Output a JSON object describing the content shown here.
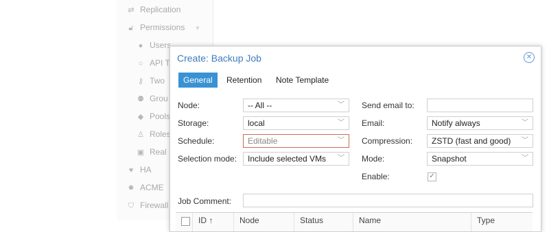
{
  "sidebar": {
    "items": [
      {
        "label": "Replication",
        "icon": "replication-icon"
      },
      {
        "label": "Permissions",
        "icon": "unlock-icon"
      },
      {
        "label": "Users",
        "icon": "user-icon"
      },
      {
        "label": "API T",
        "icon": "person-outline-icon"
      },
      {
        "label": "Two",
        "icon": "key-icon"
      },
      {
        "label": "Grou",
        "icon": "group-icon"
      },
      {
        "label": "Pools",
        "icon": "tags-icon"
      },
      {
        "label": "Roles",
        "icon": "male-icon"
      },
      {
        "label": "Real",
        "icon": "address-book-icon"
      },
      {
        "label": "HA",
        "icon": "heartbeat-icon"
      },
      {
        "label": "ACME",
        "icon": "certificate-icon"
      },
      {
        "label": "Firewall",
        "icon": "shield-icon"
      }
    ]
  },
  "dialog": {
    "title": "Create: Backup Job",
    "tabs": [
      "General",
      "Retention",
      "Note Template"
    ],
    "active_tab": "General",
    "fields": {
      "node": {
        "label": "Node:",
        "value": "-- All --"
      },
      "storage": {
        "label": "Storage:",
        "value": "local"
      },
      "schedule": {
        "label": "Schedule:",
        "placeholder": "Editable"
      },
      "selection_mode": {
        "label": "Selection mode:",
        "value": "Include selected VMs"
      },
      "send_email": {
        "label": "Send email to:",
        "value": ""
      },
      "email": {
        "label": "Email:",
        "value": "Notify always"
      },
      "compression": {
        "label": "Compression:",
        "value": "ZSTD (fast and good)"
      },
      "mode": {
        "label": "Mode:",
        "value": "Snapshot"
      },
      "enable": {
        "label": "Enable:",
        "checked": true
      },
      "job_comment": {
        "label": "Job Comment:",
        "value": ""
      }
    },
    "grid": {
      "columns": [
        "ID ↑",
        "Node",
        "Status",
        "Name",
        "Type"
      ]
    }
  },
  "colors": {
    "accent": "#3892d4",
    "title": "#3e7bbd",
    "invalid_border": "#cf6b4e"
  }
}
